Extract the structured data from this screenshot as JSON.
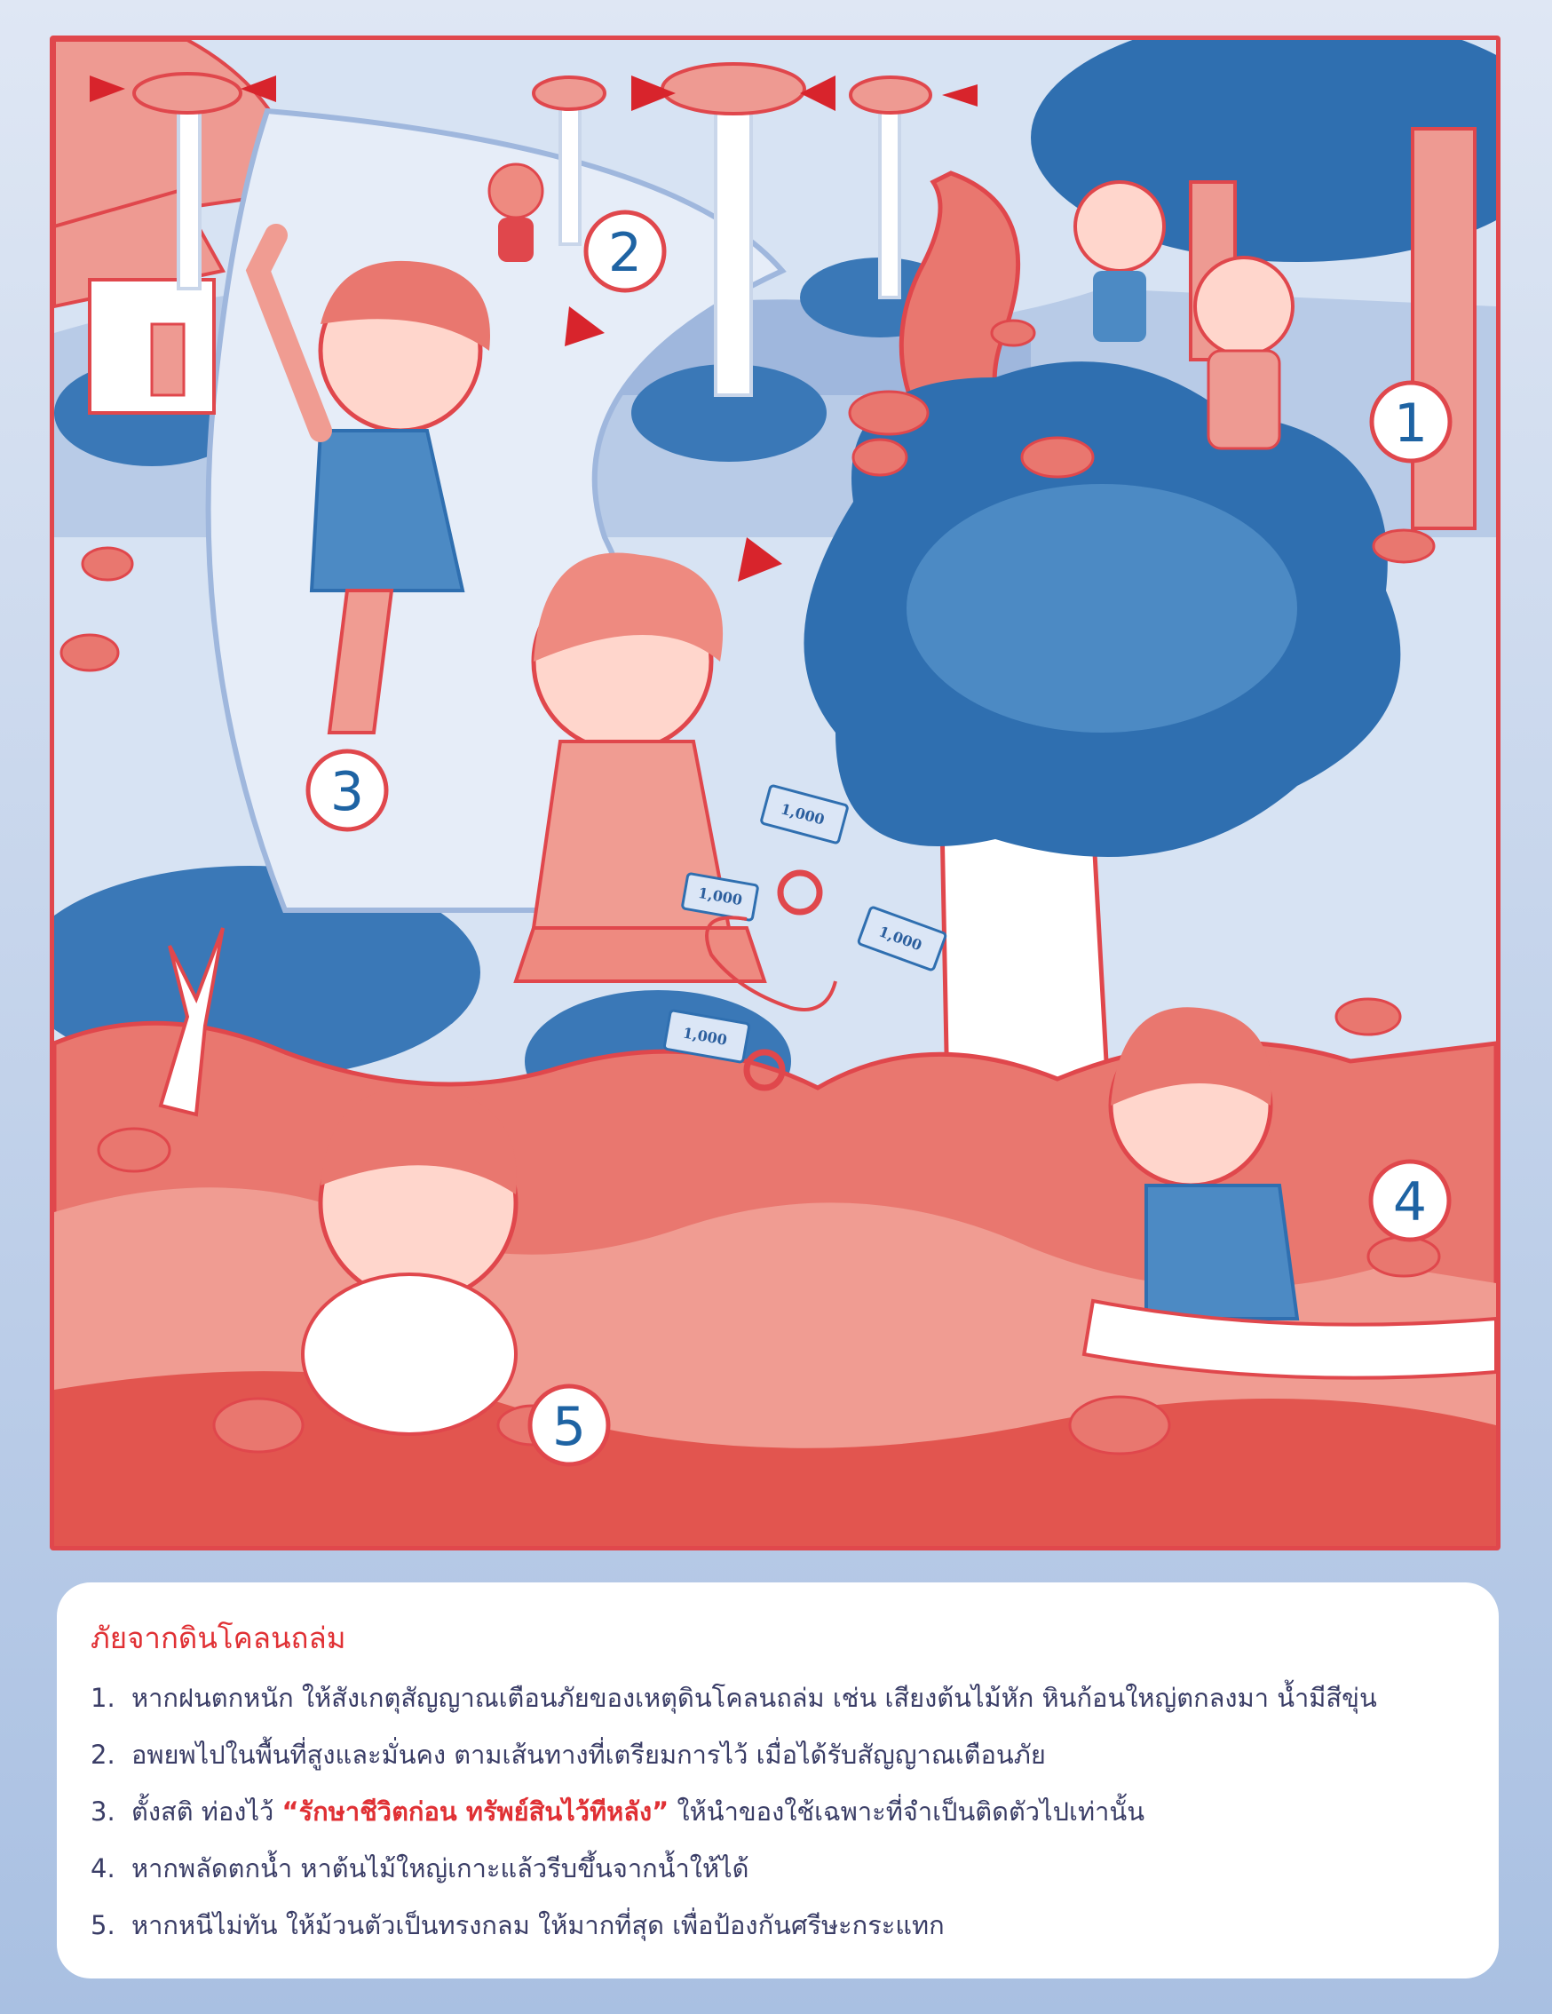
{
  "illustration": {
    "markers": [
      "1",
      "2",
      "3",
      "4",
      "5"
    ],
    "banknote_label": "1,000",
    "colors": {
      "red": "#e0474c",
      "blue": "#2f6fb0",
      "light_blue": "#cfdcef",
      "mud": "#e9776f"
    }
  },
  "panel": {
    "title": "ภัยจากดินโคลนถล่ม",
    "items": [
      {
        "num": "1.",
        "text": "หากฝนตกหนัก ให้สังเกตุสัญญาณเตือนภัยของเหตุดินโคลนถล่ม เช่น เสียงต้นไม้หัก หินก้อนใหญ่ตกลงมา น้ำมีสีขุ่น"
      },
      {
        "num": "2.",
        "text": "อพยพไปในพื้นที่สูงและมั่นคง ตามเส้นทางที่เตรียมการไว้ เมื่อได้รับสัญญาณเตือนภัย"
      },
      {
        "num": "3.",
        "prefix": "ตั้งสติ ท่องไว้ ",
        "slogan": "“รักษาชีวิตก่อน ทรัพย์สินไว้ทีหลัง”",
        "suffix": " ให้นำของใช้เฉพาะที่จำเป็นติดตัวไปเท่านั้น"
      },
      {
        "num": "4.",
        "text": "หากพลัดตกน้ำ หาต้นไม้ใหญ่เกาะแล้วรีบขึ้นจากน้ำให้ได้"
      },
      {
        "num": "5.",
        "text": "หากหนีไม่ทัน ให้ม้วนตัวเป็นทรงกลม ให้มากที่สุด เพื่อป้องกันศรีษะกระแทก"
      }
    ]
  }
}
